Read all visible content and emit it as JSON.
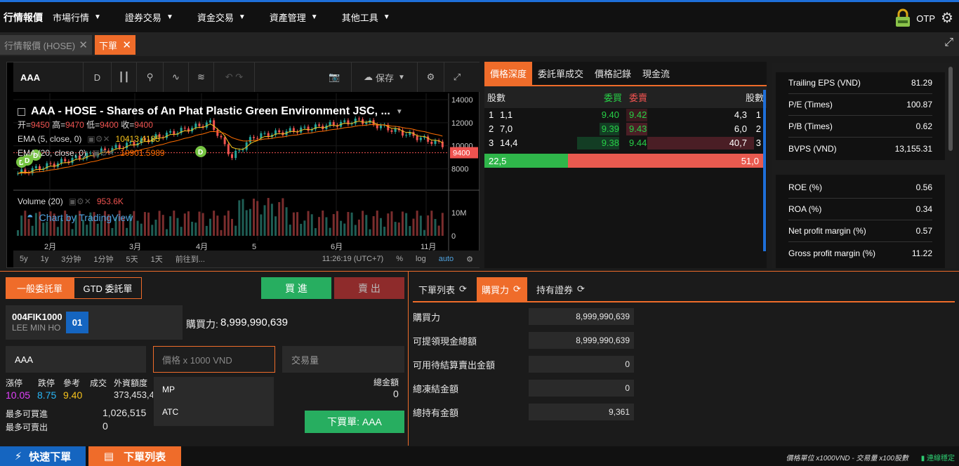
{
  "topbar": {
    "brand": "行情報價",
    "menus": [
      "市場行情",
      "證券交易",
      "資金交易",
      "資產管理",
      "其他工具"
    ],
    "otp_label": "OTP"
  },
  "tabs": [
    {
      "label": "行情報價 (HOSE)"
    },
    {
      "label": "下單"
    }
  ],
  "chart": {
    "toolbar": {
      "symbol": "AAA",
      "interval": "D",
      "save_label": "保存"
    },
    "legend_title": "AAA - HOSE - Shares of An Phat Plastic Green Environment JSC, ...",
    "ohlc": {
      "open_label": "开=",
      "open": "9450",
      "high_label": "高=",
      "high": "9470",
      "low_label": "低=",
      "low": "9400",
      "close_label": "收=",
      "close": "9400"
    },
    "ema1": {
      "label": "EMA (5, close, 0)",
      "value": "10413.4185"
    },
    "ema2": {
      "label": "EMA (20, close, 0)",
      "value": "10901.5989"
    },
    "volume": {
      "label": "Volume (20)",
      "value": "953.6K"
    },
    "watermark": "Chart by TradingView",
    "price_ticks": [
      "14000",
      "12000",
      "10000",
      "9400",
      "8000"
    ],
    "vol_ticks": [
      "10M",
      "0"
    ],
    "x_ticks": [
      "2月",
      "3月",
      "4月",
      "5",
      "6月",
      "11月"
    ],
    "bottom_bar": [
      "5y",
      "1y",
      "3分钟",
      "1分钟",
      "5天",
      "1天",
      "前往到...",
      "11:26:19 (UTC+7)",
      "%",
      "log",
      "auto"
    ]
  },
  "depth": {
    "tabs": [
      "價格深度",
      "委託單成交",
      "價格記錄",
      "現金流"
    ],
    "headers": {
      "qty_left": "股數",
      "bid": "委買",
      "ask": "委賣",
      "qty_right": "股數"
    },
    "rows": [
      {
        "idx": "1",
        "bid_qty": "1,1",
        "bid": "9.40",
        "ask": "9.42",
        "ask_qty": "4,3",
        "ridx": "1"
      },
      {
        "idx": "2",
        "bid_qty": "7,0",
        "bid": "9.39",
        "ask": "9.43",
        "ask_qty": "6,0",
        "ridx": "2"
      },
      {
        "idx": "3",
        "bid_qty": "14,4",
        "bid": "9.38",
        "ask": "9.44",
        "ask_qty": "40,7",
        "ridx": "3"
      }
    ],
    "total_bid": "22,5",
    "total_ask": "51,0",
    "bid_fraction": 0.3
  },
  "ratios": {
    "group1": [
      {
        "k": "Trailing EPS (VND)",
        "v": "81.29"
      },
      {
        "k": "P/E (Times)",
        "v": "100.87"
      },
      {
        "k": "P/B (Times)",
        "v": "0.62"
      },
      {
        "k": "BVPS (VND)",
        "v": "13,155.31"
      }
    ],
    "group2": [
      {
        "k": "ROE (%)",
        "v": "0.56"
      },
      {
        "k": "ROA (%)",
        "v": "0.34"
      },
      {
        "k": "Net profit margin (%)",
        "v": "0.57"
      },
      {
        "k": "Gross profit margin (%)",
        "v": "11.22"
      }
    ]
  },
  "order": {
    "type_tabs": [
      "一般委託單",
      "GTD 委託單"
    ],
    "buy_label": "買 進",
    "sell_label": "賣 出",
    "account_id": "004FIK1000",
    "account_name": "LEE MIN HO",
    "account_sub": "01",
    "buying_power_label": "購買力:",
    "buying_power": "8,999,990,639",
    "symbol_value": "AAA",
    "price_placeholder": "價格 x 1000 VND",
    "qty_placeholder": "交易量",
    "price_options": [
      "MP",
      "ATC"
    ],
    "stats_labels": [
      "漲停",
      "跌停",
      "參考",
      "成交",
      "外資額度"
    ],
    "ceiling": "10.05",
    "floor": "8.75",
    "ref": "9.40",
    "foreign_room": "373,453,4",
    "total_label": "總金額",
    "total_value": "0",
    "max_buy_label": "最多可買進",
    "max_buy": "1,026,515",
    "max_sell_label": "最多可賣出",
    "max_sell": "0",
    "submit_label": "下買單: AAA"
  },
  "right_panel": {
    "tabs": [
      "下單列表",
      "購買力",
      "持有證券"
    ],
    "rows": [
      {
        "k": "購買力",
        "v": "8,999,990,639"
      },
      {
        "k": "可提領現金總額",
        "v": "8,999,990,639"
      },
      {
        "k": "可用待結算賣出金額",
        "v": "0"
      },
      {
        "k": "總凍結金額",
        "v": "0"
      },
      {
        "k": "總持有金額",
        "v": "9,361"
      }
    ]
  },
  "bottom": {
    "quick_order": "快速下單",
    "order_list": "下單列表",
    "unit_note": "價格單位 x1000VND - 交易量 x100股數",
    "status": "連線穩定"
  },
  "colors": {
    "accent": "#ef6c2a",
    "buy": "#27ae60",
    "sell": "#c0392b",
    "up": "#26a69a",
    "down": "#ef5350"
  }
}
